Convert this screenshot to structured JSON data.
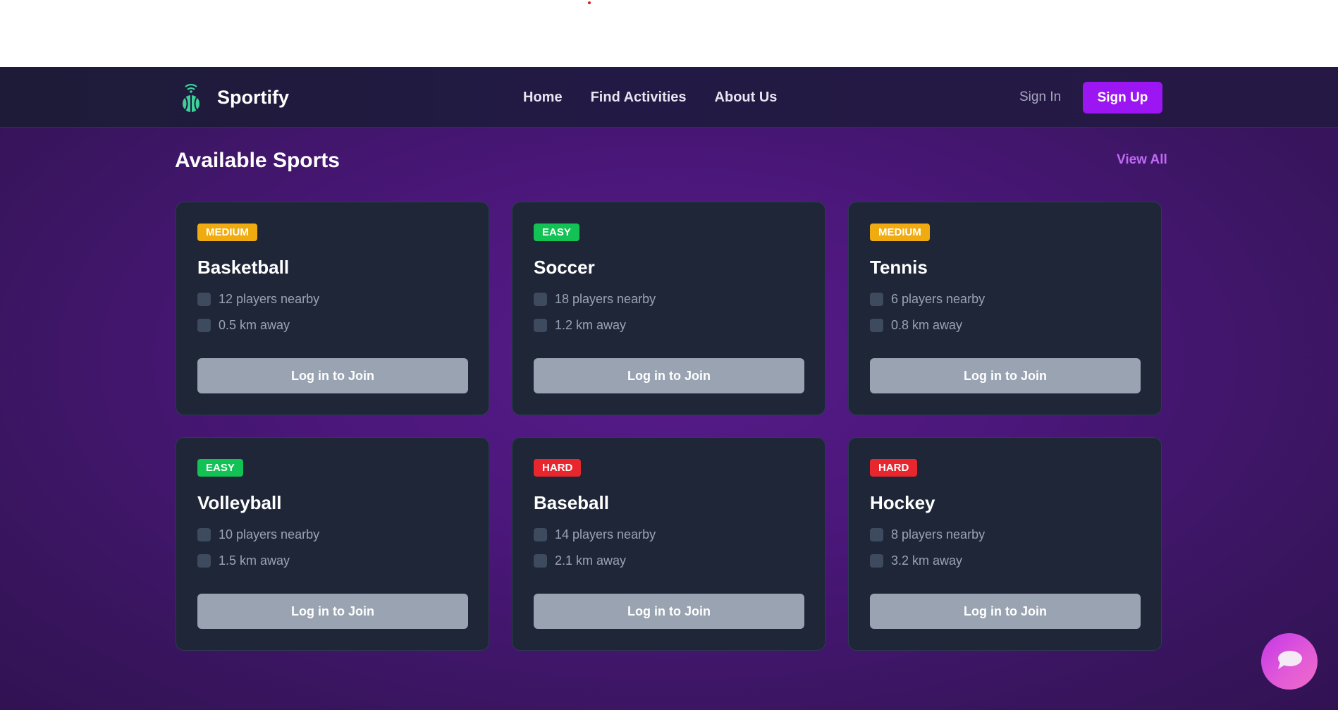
{
  "brand": {
    "name": "Sportify",
    "icon": "basketball-signal-icon"
  },
  "nav": {
    "links": [
      "Home",
      "Find Activities",
      "About Us"
    ],
    "sign_in": "Sign In",
    "sign_up": "Sign Up"
  },
  "section": {
    "title": "Available Sports",
    "view_all": "View All"
  },
  "cards": [
    {
      "difficulty": "MEDIUM",
      "difficulty_color": "#f0ab10",
      "sport": "Basketball",
      "players": "12 players nearby",
      "distance": "0.5 km away",
      "button": "Log in to Join"
    },
    {
      "difficulty": "EASY",
      "difficulty_color": "#13c254",
      "sport": "Soccer",
      "players": "18 players nearby",
      "distance": "1.2 km away",
      "button": "Log in to Join"
    },
    {
      "difficulty": "MEDIUM",
      "difficulty_color": "#f0ab10",
      "sport": "Tennis",
      "players": "6 players nearby",
      "distance": "0.8 km away",
      "button": "Log in to Join"
    },
    {
      "difficulty": "EASY",
      "difficulty_color": "#13c254",
      "sport": "Volleyball",
      "players": "10 players nearby",
      "distance": "1.5 km away",
      "button": "Log in to Join"
    },
    {
      "difficulty": "HARD",
      "difficulty_color": "#e8262e",
      "sport": "Baseball",
      "players": "14 players nearby",
      "distance": "2.1 km away",
      "button": "Log in to Join"
    },
    {
      "difficulty": "HARD",
      "difficulty_color": "#e8262e",
      "sport": "Hockey",
      "players": "8 players nearby",
      "distance": "3.2 km away",
      "button": "Log in to Join"
    }
  ],
  "chat": {
    "icon": "chat-bubble-icon"
  },
  "colors": {
    "accent": "#9b16f2",
    "link": "#c06bf5",
    "card_bg": "#1e2638"
  }
}
